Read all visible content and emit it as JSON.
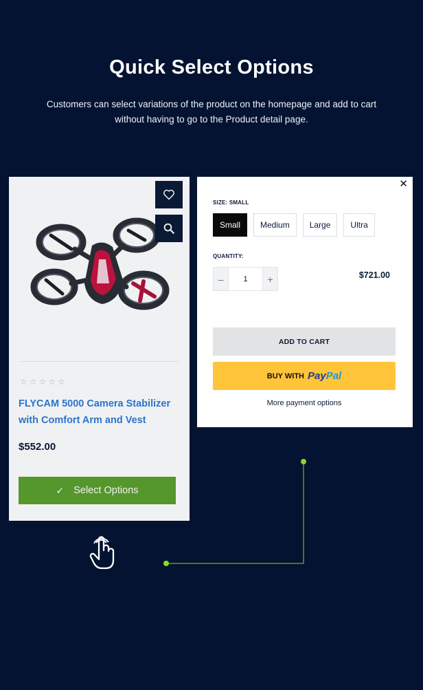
{
  "header": {
    "title": "Quick Select Options",
    "subtitle": "Customers can select variations of the product on the homepage and add to cart without having to go to the Product detail page."
  },
  "product_card": {
    "image_icon": "drone-image",
    "wishlist_icon": "heart-icon",
    "zoom_icon": "search-icon",
    "rating": 0,
    "rating_max": 5,
    "name": "FLYCAM 5000 Camera Stabilizer with Comfort Arm and Vest",
    "price": "$552.00",
    "select_options_label": "Select Options",
    "select_options_icon": "check-icon"
  },
  "popup": {
    "close_icon": "close-icon",
    "size_label": "SIZE: SMALL",
    "sizes": [
      "Small",
      "Medium",
      "Large",
      "Ultra"
    ],
    "selected_size": "Small",
    "quantity_label": "QUANTITY:",
    "quantity_value": "1",
    "qty_minus": "–",
    "qty_plus": "+",
    "price": "$721.00",
    "add_to_cart_label": "ADD TO CART",
    "buy_with_label": "BUY WITH",
    "paypal_brand_a": "Pay",
    "paypal_brand_b": "Pal",
    "more_payment_label": "More payment options"
  },
  "colors": {
    "background": "#041331",
    "accent_green": "#5ca02d",
    "connector_green": "#8ad921",
    "link_blue": "#2e7bd5",
    "paypal_yellow": "#ffc439"
  }
}
